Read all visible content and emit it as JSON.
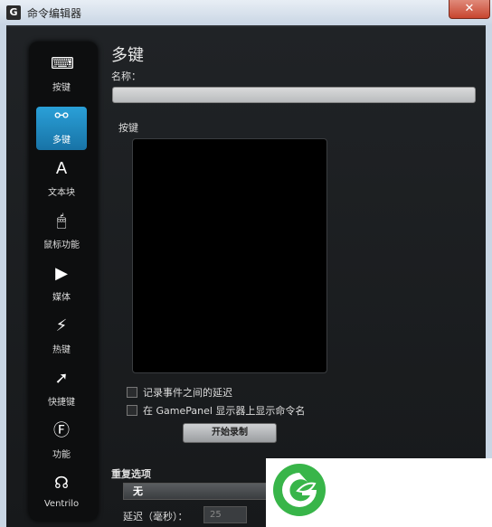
{
  "window": {
    "title": "命令编辑器",
    "logo_letter": "G",
    "close_label": "✕"
  },
  "sidebar": {
    "items": [
      {
        "label": "按键",
        "icon": "key-icon",
        "glyph": "⌨"
      },
      {
        "label": "多键",
        "icon": "multikey-icon",
        "glyph": "⚯",
        "active": true
      },
      {
        "label": "文本块",
        "icon": "text-block-icon",
        "glyph": "A"
      },
      {
        "label": "鼠标功能",
        "icon": "mouse-icon",
        "glyph": "🖱"
      },
      {
        "label": "媒体",
        "icon": "play-icon",
        "glyph": "▶"
      },
      {
        "label": "热键",
        "icon": "hotkey-icon",
        "glyph": "⚡"
      },
      {
        "label": "快捷键",
        "icon": "shortcut-arrow-icon",
        "glyph": "➚"
      },
      {
        "label": "功能",
        "icon": "function-icon",
        "glyph": "Ⓕ"
      },
      {
        "label": "Ventrilo",
        "icon": "headset-icon",
        "glyph": "☊"
      }
    ]
  },
  "main": {
    "heading": "多键",
    "name_label": "名称：",
    "name_value": "",
    "keys_label": "按键",
    "checkbox_delay": "记录事件之间的延迟",
    "checkbox_gamepanel": "在 GamePanel 显示器上显示命令名",
    "record_button": "开始录制",
    "repeat_label": "重复选项",
    "repeat_value": "无",
    "delay_label": "延迟（毫秒）：",
    "delay_value": "25"
  },
  "colors": {
    "accent": "#1f8fcf",
    "overlay_logo": "#38b549"
  }
}
